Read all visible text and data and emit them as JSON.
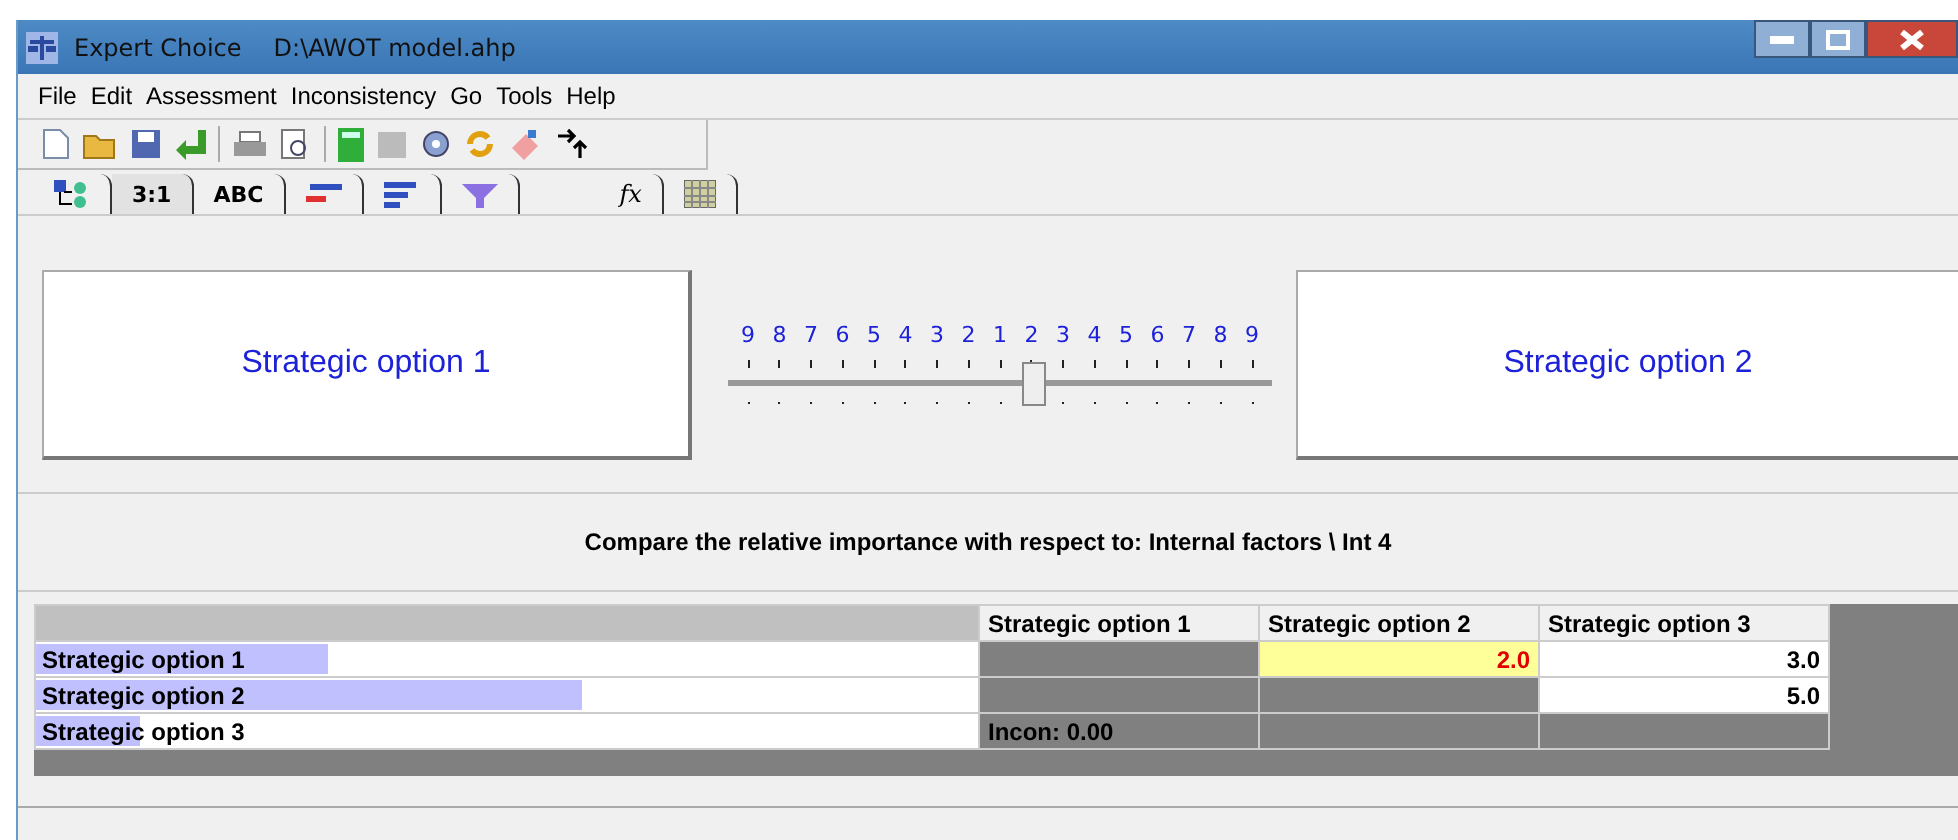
{
  "window": {
    "app": "Expert Choice",
    "file": "D:\\AWOT model.ahp"
  },
  "menu": [
    "File",
    "Edit",
    "Assessment",
    "Inconsistency",
    "Go",
    "Tools",
    "Help"
  ],
  "tabs": [
    {
      "kind": "tree",
      "selected": false
    },
    {
      "kind": "text",
      "label": "3:1",
      "selected": true
    },
    {
      "kind": "text",
      "label": "ABC",
      "selected": false
    },
    {
      "kind": "bars-red",
      "selected": false
    },
    {
      "kind": "bars",
      "selected": false
    },
    {
      "kind": "funnel",
      "selected": false
    },
    {
      "kind": "formula",
      "label": "fx",
      "selected": false
    },
    {
      "kind": "grid",
      "selected": false
    }
  ],
  "comparison": {
    "left": "Strategic option 1",
    "right": "Strategic option 2",
    "scale": [
      "9",
      "8",
      "7",
      "6",
      "5",
      "4",
      "3",
      "2",
      "1",
      "2",
      "3",
      "4",
      "5",
      "6",
      "7",
      "8",
      "9"
    ],
    "level": 0.5625
  },
  "prompt": "Compare the relative importance with respect to: Internal factors \\ Int 4",
  "matrix": {
    "columns": [
      "Strategic option 1",
      "Strategic option 2",
      "Strategic option 3"
    ],
    "rows": [
      {
        "label": "Strategic option 1",
        "level": 0.31,
        "cells": [
          {
            "kind": "blank"
          },
          {
            "kind": "value",
            "text": "2.0",
            "selected": true
          },
          {
            "kind": "value",
            "text": "3.0",
            "selected": false
          }
        ]
      },
      {
        "label": "Strategic option 2",
        "level": 0.58,
        "cells": [
          {
            "kind": "blank"
          },
          {
            "kind": "blank"
          },
          {
            "kind": "value",
            "text": "5.0",
            "selected": false
          }
        ]
      },
      {
        "label": "Strategic option 3",
        "level": 0.11,
        "cells": [
          {
            "kind": "note",
            "text": "Incon: 0.00"
          },
          {
            "kind": "blank"
          },
          {
            "kind": "blank"
          }
        ]
      }
    ]
  }
}
